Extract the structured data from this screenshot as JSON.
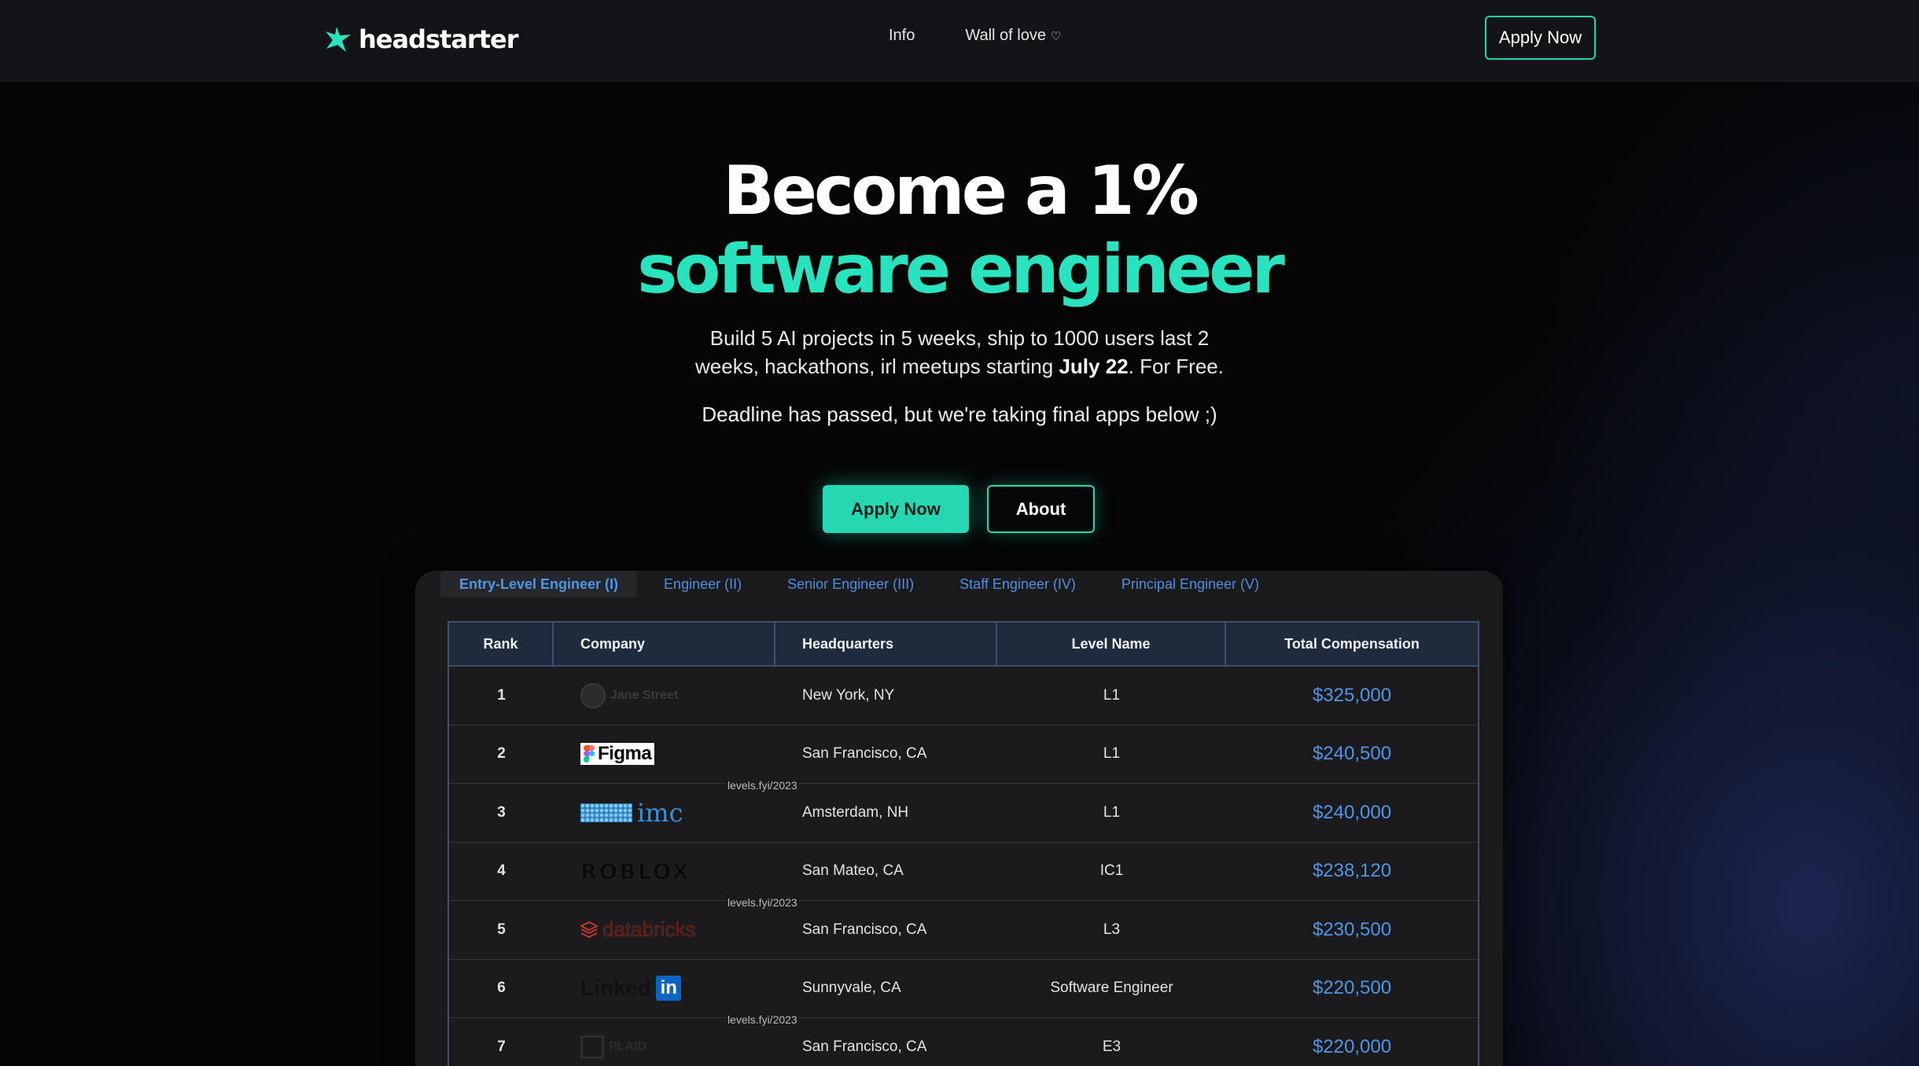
{
  "nav": {
    "brand": "headstarter",
    "links": [
      {
        "label": "Info"
      },
      {
        "label": "Wall of love",
        "icon": "heart-icon",
        "glyph": "♡"
      }
    ],
    "apply_label": "Apply Now"
  },
  "hero": {
    "title_line1": "Become a 1%",
    "title_line2": "software engineer",
    "sub_part1": "Build 5 AI projects in 5 weeks, ship to 1000 users last 2 weeks, hackathons, irl meetups starting ",
    "sub_bold": "July 22",
    "sub_part2": ". For Free.",
    "deadline": "Deadline has passed, but we're taking final apps below ;)",
    "apply_label": "Apply Now",
    "about_label": "About"
  },
  "colors": {
    "accent": "#28e3bd",
    "link_blue": "#4f95e8",
    "nav_bg": "#131418",
    "panel_bg": "#1b1b1d"
  },
  "levels": {
    "tabs": [
      {
        "label": "Entry-Level Engineer (I)",
        "active": true
      },
      {
        "label": "Engineer (II)"
      },
      {
        "label": "Senior Engineer (III)"
      },
      {
        "label": "Staff Engineer (IV)"
      },
      {
        "label": "Principal Engineer (V)"
      }
    ],
    "columns": [
      "Rank",
      "Company",
      "Headquarters",
      "Level Name",
      "Total Compensation"
    ],
    "watermark": "levels.fyi/2023",
    "rows": [
      {
        "rank": "1",
        "company": "Jane Street",
        "hq": "New York, NY",
        "level": "L1",
        "comp": "$325,000"
      },
      {
        "rank": "2",
        "company": "Figma",
        "hq": "San Francisco, CA",
        "level": "L1",
        "comp": "$240,500"
      },
      {
        "rank": "3",
        "company": "imc",
        "hq": "Amsterdam, NH",
        "level": "L1",
        "comp": "$240,000"
      },
      {
        "rank": "4",
        "company": "ROBLOX",
        "hq": "San Mateo, CA",
        "level": "IC1",
        "comp": "$238,120"
      },
      {
        "rank": "5",
        "company": "databricks",
        "hq": "San Francisco, CA",
        "level": "L3",
        "comp": "$230,500"
      },
      {
        "rank": "6",
        "company": "Linked",
        "company_badge": "in",
        "hq": "Sunnyvale, CA",
        "level": "Software Engineer",
        "comp": "$220,500"
      },
      {
        "rank": "7",
        "company": "PLAID",
        "hq": "San Francisco, CA",
        "level": "E3",
        "comp": "$220,000"
      }
    ]
  }
}
